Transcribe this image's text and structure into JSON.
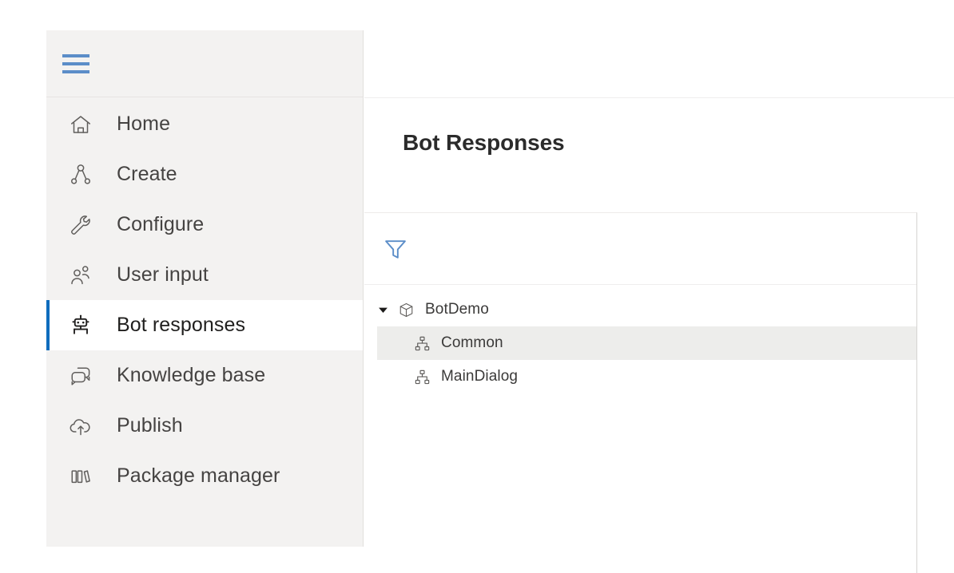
{
  "sidebar": {
    "menu_button": {
      "name": "hamburger-menu",
      "label": "Menu"
    },
    "items": [
      {
        "label": "Home",
        "icon": "home-icon",
        "selected": false
      },
      {
        "label": "Create",
        "icon": "flow-node-icon",
        "selected": false
      },
      {
        "label": "Configure",
        "icon": "wrench-icon",
        "selected": false
      },
      {
        "label": "User input",
        "icon": "people-icon",
        "selected": false
      },
      {
        "label": "Bot responses",
        "icon": "robot-icon",
        "selected": true
      },
      {
        "label": "Knowledge base",
        "icon": "chat-bubbles-icon",
        "selected": false
      },
      {
        "label": "Publish",
        "icon": "cloud-upload-icon",
        "selected": false
      },
      {
        "label": "Package manager",
        "icon": "books-icon",
        "selected": false
      }
    ]
  },
  "main": {
    "page_title": "Bot Responses",
    "filter": {
      "icon": "filter-funnel-icon",
      "label": "Filter"
    },
    "tree": [
      {
        "label": "BotDemo",
        "icon": "cube-icon",
        "level": 0,
        "expanded": true,
        "highlighted": false
      },
      {
        "label": "Common",
        "icon": "hierarchy-icon",
        "level": 1,
        "expanded": null,
        "highlighted": true
      },
      {
        "label": "MainDialog",
        "icon": "hierarchy-icon",
        "level": 1,
        "expanded": null,
        "highlighted": false
      }
    ]
  },
  "colors": {
    "accent": "#0f6cbd",
    "hamburger": "#5b8dc8",
    "filter_icon": "#5b8dc8",
    "sidebar_bg": "#f3f2f1",
    "selected_row_bg": "#ededeb"
  }
}
